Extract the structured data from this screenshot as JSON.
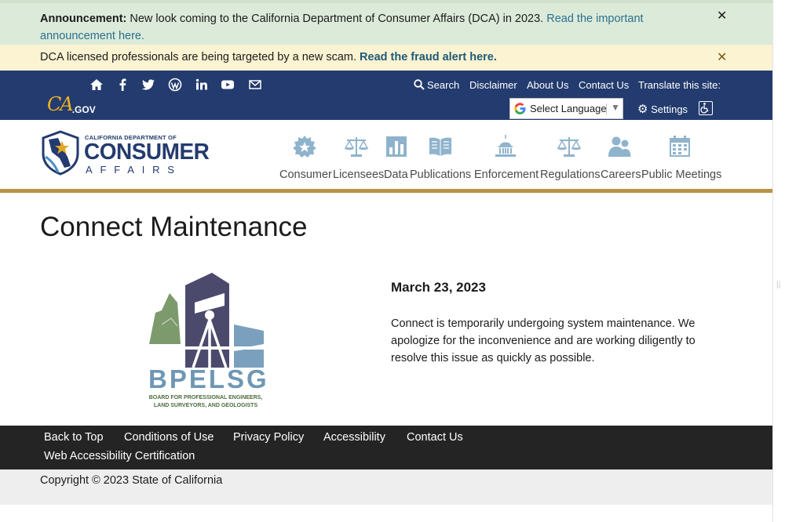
{
  "announcement": {
    "label": "Announcement:",
    "text": "New look coming to the California Department of Consumer Affairs (DCA) in 2023.",
    "link": "Read the important announcement here."
  },
  "fraud_alert": {
    "text": "DCA licensed professionals are being targeted by a new scam.",
    "link": "Read the fraud alert here."
  },
  "utility": {
    "social_icons": [
      "home-icon",
      "facebook-icon",
      "twitter-icon",
      "wordpress-icon",
      "linkedin-icon",
      "youtube-icon",
      "email-icon"
    ],
    "search": "Search",
    "disclaimer": "Disclaimer",
    "about": "About Us",
    "contact": "Contact Us",
    "translate": "Translate this site:",
    "language": "Select Language",
    "settings": "Settings"
  },
  "cagov": {
    "ca": "CA",
    "gov": ".GOV"
  },
  "logo": {
    "line1": "CALIFORNIA DEPARTMENT OF",
    "line2": "CONSUMER",
    "line3": "AFFAIRS"
  },
  "nav": [
    {
      "label": "Consumer",
      "icon": "badge-icon"
    },
    {
      "label": "Licensees",
      "icon": "scales-icon"
    },
    {
      "label": "Data",
      "icon": "bar-chart-icon"
    },
    {
      "label": "Publications",
      "icon": "book-icon"
    },
    {
      "label": "Enforcement",
      "icon": "capitol-icon"
    },
    {
      "label": "Regulations",
      "icon": "scales-icon"
    },
    {
      "label": "Careers",
      "icon": "people-icon"
    },
    {
      "label": "Public Meetings",
      "icon": "calendar-icon"
    }
  ],
  "page": {
    "title": "Connect Maintenance",
    "date": "March 23, 2023",
    "message": "Connect is temporarily undergoing system maintenance. We apologize for the inconvenience and are working diligently to resolve this issue as quickly as possible."
  },
  "bpelsg": {
    "name": "BPELSG",
    "sub1": "BOARD FOR PROFESSIONAL ENGINEERS,",
    "sub2": "LAND SURVEYORS, AND GEOLOGISTS"
  },
  "footer": {
    "links": [
      "Back to Top",
      "Conditions of Use",
      "Privacy Policy",
      "Accessibility",
      "Contact Us",
      "Web Accessibility Certification"
    ],
    "copyright": "Copyright © 2023 State of California"
  },
  "colors": {
    "header_navy": "#233b6e",
    "gold_accent": "#b99443",
    "announcement_bg": "#dcebd9",
    "fraud_bg": "#fbf3d2",
    "footer_bg": "#242424",
    "nav_icon": "#8fb3cc"
  }
}
